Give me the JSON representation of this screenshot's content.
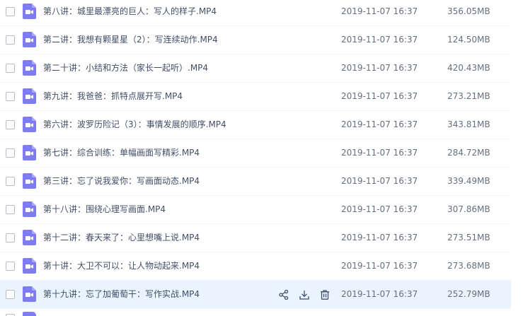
{
  "files": [
    {
      "name": "第八讲：城里最漂亮的巨人：写人的样子.MP4",
      "date": "2019-11-07 16:37",
      "size": "356.05MB"
    },
    {
      "name": "第二讲：我想有颗星星（2）：写连续动作.MP4",
      "date": "2019-11-07 16:37",
      "size": "124.50MB"
    },
    {
      "name": "第二十讲：小结和方法（家长一起听）.MP4",
      "date": "2019-11-07 16:37",
      "size": "420.43MB"
    },
    {
      "name": "第九讲：我爸爸：抓特点展开写.MP4",
      "date": "2019-11-07 16:37",
      "size": "273.21MB"
    },
    {
      "name": "第六讲：波罗历险记（3）：事情发展的顺序.MP4",
      "date": "2019-11-07 16:37",
      "size": "343.81MB"
    },
    {
      "name": "第七讲：综合训练：单幅画面写精彩.MP4",
      "date": "2019-11-07 16:37",
      "size": "284.72MB"
    },
    {
      "name": "第三讲：忘了说我爱你：写画面动态.MP4",
      "date": "2019-11-07 16:37",
      "size": "339.49MB"
    },
    {
      "name": "第十八讲：围绕心理写画面.MP4",
      "date": "2019-11-07 16:37",
      "size": "307.86MB"
    },
    {
      "name": "第十二讲：春天来了：心里想嘴上说.MP4",
      "date": "2019-11-07 16:37",
      "size": "273.51MB"
    },
    {
      "name": "第十讲：大卫不可以：让人物动起来.MP4",
      "date": "2019-11-07 16:37",
      "size": "273.68MB"
    },
    {
      "name": "第十九讲：忘了加葡萄干：写作实战.MP4",
      "date": "2019-11-07 16:37",
      "size": "252.79MB"
    }
  ],
  "hovered_row": 10,
  "row_actions": [
    "share-icon",
    "download-icon",
    "delete-icon"
  ],
  "colors": {
    "video_icon": "#7f7bf2",
    "hover_background": "#eaf4fe",
    "action_icon": "#424e67"
  }
}
